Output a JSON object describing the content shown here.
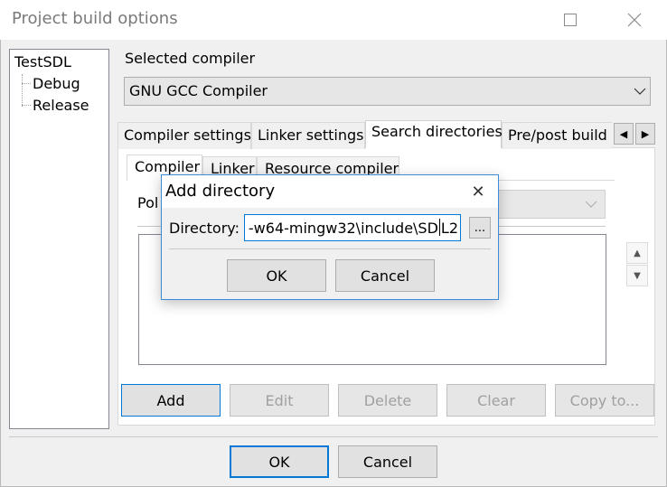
{
  "window": {
    "title": "Project build options",
    "maximize_icon": "maximize-icon",
    "close_icon": "close-icon"
  },
  "tree": {
    "root": "TestSDL",
    "children": [
      "Debug",
      "Release"
    ]
  },
  "compiler": {
    "label": "Selected compiler",
    "value": "GNU GCC Compiler"
  },
  "tabs": [
    "Compiler settings",
    "Linker settings",
    "Search directories",
    "Pre/post build"
  ],
  "active_tab": "Search directories",
  "tab_scroll": {
    "left": "◀",
    "right": "▶"
  },
  "inner_tabs": [
    "Compiler",
    "Linker",
    "Resource compiler"
  ],
  "active_inner_tab": "Compiler",
  "policy": {
    "label": "Pol"
  },
  "spin": {
    "up": "▲",
    "down": "▼"
  },
  "action_buttons": [
    {
      "label": "Add",
      "enabled": true
    },
    {
      "label": "Edit",
      "enabled": false
    },
    {
      "label": "Delete",
      "enabled": false
    },
    {
      "label": "Clear",
      "enabled": false
    },
    {
      "label": "Copy to...",
      "enabled": false
    }
  ],
  "footer": {
    "ok": "OK",
    "cancel": "Cancel"
  },
  "dialog": {
    "title": "Add directory",
    "close": "✕",
    "label": "Directory:",
    "value_before_caret": "-w64-mingw32\\include\\SD",
    "value_after_caret": "L2",
    "browse": "...",
    "ok": "OK",
    "cancel": "Cancel"
  },
  "colors": {
    "focus_border": "#0078d7",
    "dialog_border": "#3c8bd6"
  }
}
